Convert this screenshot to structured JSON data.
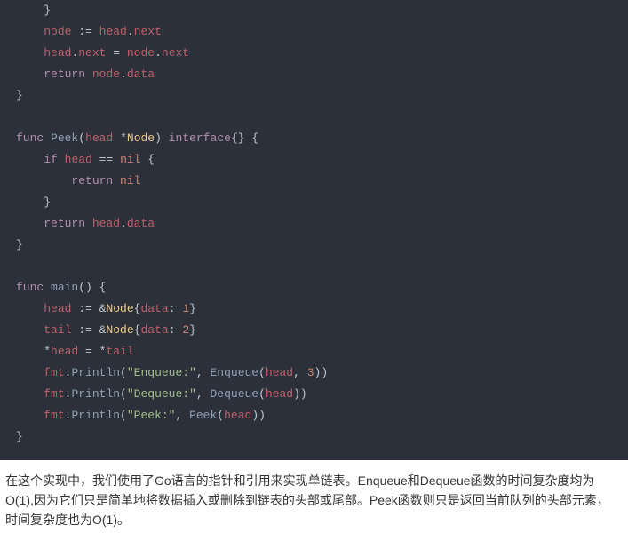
{
  "code": {
    "lines": [
      {
        "indent": 1,
        "t": [
          {
            "c": "default",
            "v": "}"
          }
        ]
      },
      {
        "indent": 1,
        "t": [
          {
            "c": "var",
            "v": "node"
          },
          {
            "c": "default",
            "v": " := "
          },
          {
            "c": "var",
            "v": "head"
          },
          {
            "c": "default",
            "v": "."
          },
          {
            "c": "var",
            "v": "next"
          }
        ]
      },
      {
        "indent": 1,
        "t": [
          {
            "c": "var",
            "v": "head"
          },
          {
            "c": "default",
            "v": "."
          },
          {
            "c": "var",
            "v": "next"
          },
          {
            "c": "default",
            "v": " = "
          },
          {
            "c": "var",
            "v": "node"
          },
          {
            "c": "default",
            "v": "."
          },
          {
            "c": "var",
            "v": "next"
          }
        ]
      },
      {
        "indent": 1,
        "t": [
          {
            "c": "keyword",
            "v": "return"
          },
          {
            "c": "default",
            "v": " "
          },
          {
            "c": "var",
            "v": "node"
          },
          {
            "c": "default",
            "v": "."
          },
          {
            "c": "var",
            "v": "data"
          }
        ]
      },
      {
        "indent": 0,
        "t": [
          {
            "c": "default",
            "v": "}"
          }
        ]
      },
      {
        "indent": 0,
        "t": [
          {
            "c": "default",
            "v": " "
          }
        ]
      },
      {
        "indent": 0,
        "t": [
          {
            "c": "keyword",
            "v": "func"
          },
          {
            "c": "default",
            "v": " "
          },
          {
            "c": "funcdef",
            "v": "Peek"
          },
          {
            "c": "default",
            "v": "("
          },
          {
            "c": "var",
            "v": "head"
          },
          {
            "c": "default",
            "v": " *"
          },
          {
            "c": "type",
            "v": "Node"
          },
          {
            "c": "default",
            "v": ") "
          },
          {
            "c": "keyword",
            "v": "interface"
          },
          {
            "c": "default",
            "v": "{} {"
          }
        ]
      },
      {
        "indent": 1,
        "t": [
          {
            "c": "keyword",
            "v": "if"
          },
          {
            "c": "default",
            "v": " "
          },
          {
            "c": "var",
            "v": "head"
          },
          {
            "c": "default",
            "v": " == "
          },
          {
            "c": "nil",
            "v": "nil"
          },
          {
            "c": "default",
            "v": " {"
          }
        ]
      },
      {
        "indent": 2,
        "t": [
          {
            "c": "keyword",
            "v": "return"
          },
          {
            "c": "default",
            "v": " "
          },
          {
            "c": "nil",
            "v": "nil"
          }
        ]
      },
      {
        "indent": 1,
        "t": [
          {
            "c": "default",
            "v": "}"
          }
        ]
      },
      {
        "indent": 1,
        "t": [
          {
            "c": "keyword",
            "v": "return"
          },
          {
            "c": "default",
            "v": " "
          },
          {
            "c": "var",
            "v": "head"
          },
          {
            "c": "default",
            "v": "."
          },
          {
            "c": "var",
            "v": "data"
          }
        ]
      },
      {
        "indent": 0,
        "t": [
          {
            "c": "default",
            "v": "}"
          }
        ]
      },
      {
        "indent": 0,
        "t": [
          {
            "c": "default",
            "v": " "
          }
        ]
      },
      {
        "indent": 0,
        "t": [
          {
            "c": "keyword",
            "v": "func"
          },
          {
            "c": "default",
            "v": " "
          },
          {
            "c": "funcdef",
            "v": "main"
          },
          {
            "c": "default",
            "v": "() {"
          }
        ]
      },
      {
        "indent": 1,
        "t": [
          {
            "c": "var",
            "v": "head"
          },
          {
            "c": "default",
            "v": " := &"
          },
          {
            "c": "type",
            "v": "Node"
          },
          {
            "c": "default",
            "v": "{"
          },
          {
            "c": "var",
            "v": "data"
          },
          {
            "c": "default",
            "v": ": "
          },
          {
            "c": "number",
            "v": "1"
          },
          {
            "c": "default",
            "v": "}"
          }
        ]
      },
      {
        "indent": 1,
        "t": [
          {
            "c": "var",
            "v": "tail"
          },
          {
            "c": "default",
            "v": " := &"
          },
          {
            "c": "type",
            "v": "Node"
          },
          {
            "c": "default",
            "v": "{"
          },
          {
            "c": "var",
            "v": "data"
          },
          {
            "c": "default",
            "v": ": "
          },
          {
            "c": "number",
            "v": "2"
          },
          {
            "c": "default",
            "v": "}"
          }
        ]
      },
      {
        "indent": 1,
        "t": [
          {
            "c": "default",
            "v": "*"
          },
          {
            "c": "var",
            "v": "head"
          },
          {
            "c": "default",
            "v": " = *"
          },
          {
            "c": "var",
            "v": "tail"
          }
        ]
      },
      {
        "indent": 1,
        "t": [
          {
            "c": "var",
            "v": "fmt"
          },
          {
            "c": "default",
            "v": "."
          },
          {
            "c": "method",
            "v": "Println"
          },
          {
            "c": "default",
            "v": "("
          },
          {
            "c": "string",
            "v": "\"Enqueue:\""
          },
          {
            "c": "default",
            "v": ", "
          },
          {
            "c": "method",
            "v": "Enqueue"
          },
          {
            "c": "default",
            "v": "("
          },
          {
            "c": "var",
            "v": "head"
          },
          {
            "c": "default",
            "v": ", "
          },
          {
            "c": "number",
            "v": "3"
          },
          {
            "c": "default",
            "v": "))"
          }
        ]
      },
      {
        "indent": 1,
        "t": [
          {
            "c": "var",
            "v": "fmt"
          },
          {
            "c": "default",
            "v": "."
          },
          {
            "c": "method",
            "v": "Println"
          },
          {
            "c": "default",
            "v": "("
          },
          {
            "c": "string",
            "v": "\"Dequeue:\""
          },
          {
            "c": "default",
            "v": ", "
          },
          {
            "c": "method",
            "v": "Dequeue"
          },
          {
            "c": "default",
            "v": "("
          },
          {
            "c": "var",
            "v": "head"
          },
          {
            "c": "default",
            "v": "))"
          }
        ]
      },
      {
        "indent": 1,
        "t": [
          {
            "c": "var",
            "v": "fmt"
          },
          {
            "c": "default",
            "v": "."
          },
          {
            "c": "method",
            "v": "Println"
          },
          {
            "c": "default",
            "v": "("
          },
          {
            "c": "string",
            "v": "\"Peek:\""
          },
          {
            "c": "default",
            "v": ", "
          },
          {
            "c": "method",
            "v": "Peek"
          },
          {
            "c": "default",
            "v": "("
          },
          {
            "c": "var",
            "v": "head"
          },
          {
            "c": "default",
            "v": "))"
          }
        ]
      },
      {
        "indent": 0,
        "t": [
          {
            "c": "default",
            "v": "}"
          }
        ]
      }
    ]
  },
  "prose": {
    "p1": "在这个实现中，我们使用了Go语言的指针和引用来实现单链表。Enqueue和Dequeue函数的时间复杂度均为O(1),因为它们只是简单地将数据插入或删除到链表的头部或尾部。Peek函数则只是返回当前队列的头部元素，时间复杂度也为O(1)。"
  }
}
